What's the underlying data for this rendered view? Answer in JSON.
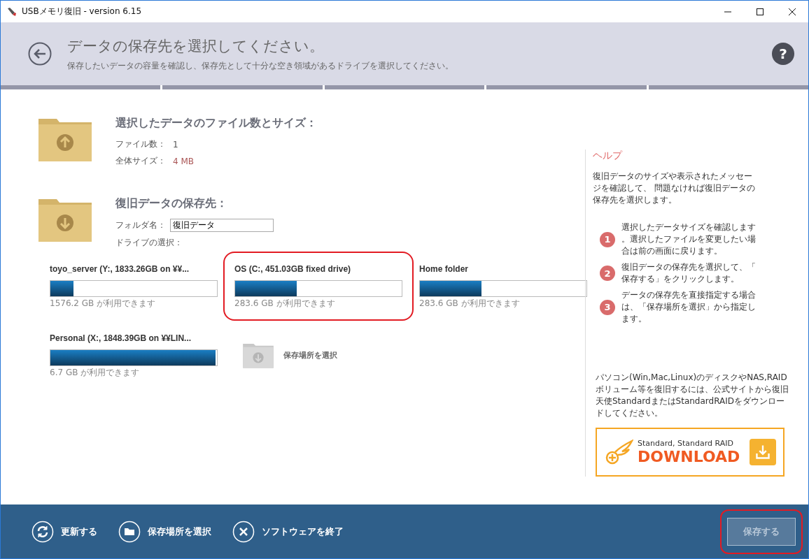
{
  "window": {
    "title": "USBメモリ復旧 - version 6.15"
  },
  "header": {
    "title": "データの保存先を選択してください。",
    "subtitle": "保存したいデータの容量を確認し、保存先として十分な空き領域があるドライブを選択してください。",
    "help_button": "?"
  },
  "selected_data": {
    "heading": "選択したデータのファイル数とサイズ：",
    "rows": [
      {
        "label": "ファイル数：",
        "value": "1"
      },
      {
        "label": "全体サイズ：",
        "value": "4 MB"
      }
    ]
  },
  "destination": {
    "heading": "復旧データの保存先：",
    "folder_label": "フォルダ名：",
    "folder_value": "復旧データ",
    "drive_label": "ドライブの選択：",
    "drives": [
      {
        "name": "toyo_server (Y:, 1833.26GB on ¥¥...",
        "level": 0.14,
        "free": "1576.2 GB が利用できます",
        "highlighted": false
      },
      {
        "name": "OS (C:, 451.03GB fixed drive)",
        "level": 0.37,
        "free": "283.6 GB が利用できます",
        "highlighted": true
      },
      {
        "name": "Home folder",
        "level": 0.37,
        "free": "283.6 GB が利用できます",
        "highlighted": false
      },
      {
        "name": "Personal (X:, 1848.39GB on ¥¥LIN...",
        "level": 0.99,
        "free": "6.7 GB が利用できます",
        "highlighted": false
      }
    ],
    "browse": "保存場所を選択"
  },
  "help": {
    "title": "ヘルプ",
    "intro": "復旧データのサイズや表示されたメッセージを確認して、 問題なければ復旧データの保存先を選択します。",
    "steps": [
      {
        "number": "1",
        "text": "選択したデータサイズを確認します。選択したファイルを変更したい場合は前の画面に戻ります。"
      },
      {
        "number": "2",
        "text": "復旧データの保存先を選択して、「保存する」をクリックします。"
      },
      {
        "number": "3",
        "text": "データの保存先を直接指定する場合は、「保存場所を選択」から指定します。"
      }
    ],
    "note": "パソコン(Win,Mac,Linux)のディスクやNAS,RAIDボリューム等を復旧するには、公式サイトから復旧天使StandardまたはStandardRAIDをダウンロードしてください。",
    "download": {
      "caption": "Standard, Standard RAID",
      "label": "DOWNLOAD"
    }
  },
  "footer": {
    "actions": [
      {
        "kind": "refresh",
        "label": "更新する"
      },
      {
        "kind": "folder",
        "label": "保存場所を選択"
      },
      {
        "kind": "close",
        "label": "ソフトウェアを終了"
      }
    ],
    "save": {
      "label": "保存する",
      "highlighted": true
    }
  }
}
